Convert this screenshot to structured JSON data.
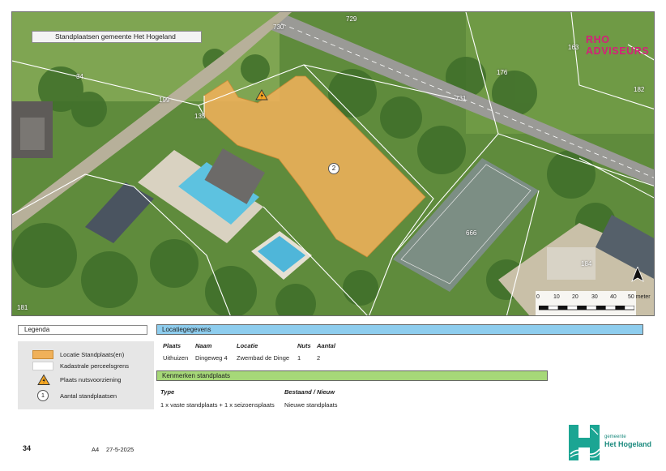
{
  "map": {
    "title": "Standplaatsen gemeente Het Hogeland",
    "brand": "RHO ADVISEURS",
    "parcel_numbers": [
      "729",
      "730",
      "163",
      "176",
      "182",
      "34",
      "199",
      "731",
      "135",
      "666",
      "184",
      "181"
    ],
    "count_marker": "2",
    "scale_labels": [
      "0",
      "10",
      "20",
      "30",
      "40",
      "50 meter"
    ],
    "colors": {
      "standplaats_fill": "#f0b15a",
      "parcel_line": "#ffffff",
      "grass": "#6f9a45",
      "road": "#9a9a96"
    }
  },
  "legend": {
    "title": "Legenda",
    "items": [
      {
        "symbol": "orange-fill",
        "label": "Locatie Standplaats(en)"
      },
      {
        "symbol": "parcel-outline",
        "label": "Kadastrale perceelsgrens"
      },
      {
        "symbol": "warning-icon",
        "label": "Plaats nutsvoorziening"
      },
      {
        "symbol": "count-circle",
        "symbol_text": "1",
        "label": "Aantal standplaatsen"
      }
    ]
  },
  "locatie": {
    "header": "Locatiegegevens",
    "columns": [
      "Plaats",
      "Naam",
      "Locatie",
      "Nuts",
      "Aantal"
    ],
    "row": [
      "Uithuizen",
      "Dingeweg 4",
      "Zwembad de Dinge",
      "1",
      "2"
    ]
  },
  "kenmerken": {
    "header": "Kenmerken standplaats",
    "columns": [
      "Type",
      "Bestaand / Nieuw"
    ],
    "row": [
      "1 x vaste standplaats + 1 x seizoensplaats",
      "Nieuwe standplaats"
    ]
  },
  "footer": {
    "page_number": "34",
    "paper_size": "A4",
    "date": "27-5-2025",
    "logo_small": "gemeente",
    "logo_name": "Het Hogeland"
  }
}
